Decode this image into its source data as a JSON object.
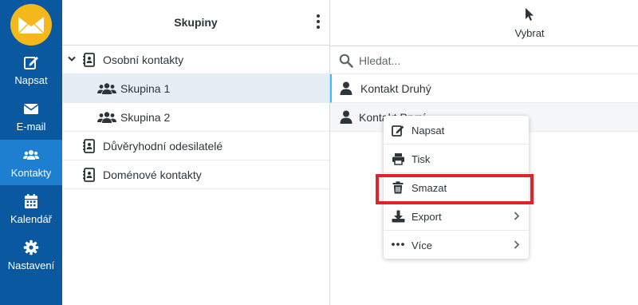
{
  "nav": {
    "items": [
      {
        "label": "Napsat",
        "icon": "compose-icon"
      },
      {
        "label": "E-mail",
        "icon": "envelope-icon"
      },
      {
        "label": "Kontakty",
        "icon": "users-icon",
        "active": true
      },
      {
        "label": "Kalendář",
        "icon": "calendar-icon"
      },
      {
        "label": "Nastavení",
        "icon": "gear-icon"
      }
    ],
    "logo_icon": "mail-logo-icon"
  },
  "groups": {
    "title": "Skupiny",
    "tree": [
      {
        "label": "Osobní kontakty",
        "icon": "address-book-icon",
        "expanded": true
      },
      {
        "label": "Skupina 1",
        "icon": "users-icon",
        "selected": true
      },
      {
        "label": "Skupina 2",
        "icon": "users-icon"
      },
      {
        "label": "Důvěryhodní odesilatelé",
        "icon": "address-book-icon"
      },
      {
        "label": "Doménové kontakty",
        "icon": "address-book-icon"
      }
    ]
  },
  "contacts": {
    "select_label": "Vybrat",
    "search_placeholder": "Hledat...",
    "list": [
      {
        "name": "Kontakt Druhý"
      },
      {
        "name": "Kontakt První"
      }
    ]
  },
  "context_menu": {
    "items": [
      {
        "label": "Napsat",
        "icon": "compose-icon"
      },
      {
        "label": "Tisk",
        "icon": "printer-icon"
      },
      {
        "label": "Smazat",
        "icon": "trash-icon"
      },
      {
        "label": "Export",
        "icon": "download-icon",
        "submenu": true
      },
      {
        "label": "Více",
        "icon": "ellipsis-icon",
        "submenu": true
      }
    ]
  },
  "colors": {
    "nav_bg": "#0a59a0",
    "nav_active": "#1e7ecf",
    "logo": "#f5b81c",
    "highlight": "#e0222b",
    "focus": "#37beff"
  }
}
